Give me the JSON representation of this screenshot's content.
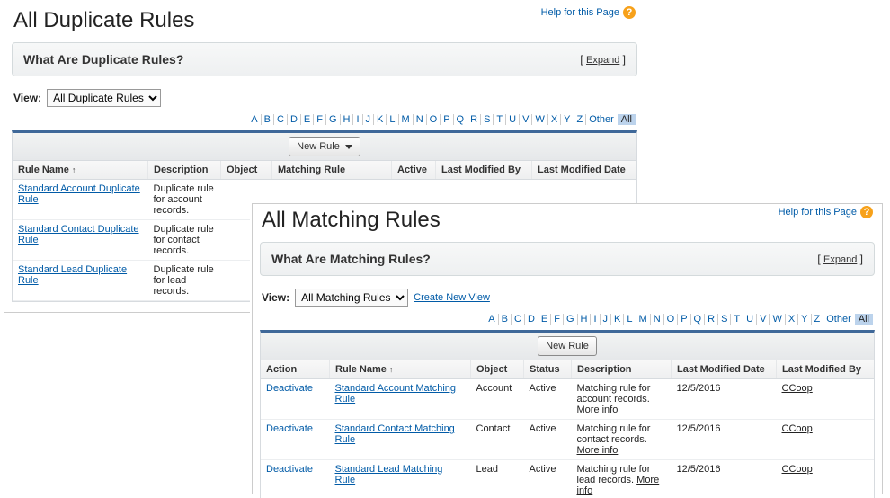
{
  "help_label": "Help for this Page",
  "expand_label": "Expand",
  "view_label": "View:",
  "other_label": "Other",
  "all_label": "All",
  "create_view_label": "Create New View",
  "sort_arrow": "↑",
  "dup": {
    "title": "All Duplicate Rules",
    "info_title": "What Are Duplicate Rules?",
    "view_value": "All Duplicate Rules",
    "new_button": "New Rule",
    "columns": {
      "rule": "Rule Name",
      "desc": "Description",
      "object": "Object",
      "matching": "Matching Rule",
      "active": "Active",
      "modby": "Last Modified By",
      "moddate": "Last Modified Date"
    },
    "rows": [
      {
        "name": "Standard Account Duplicate Rule",
        "desc": "Duplicate rule for account records."
      },
      {
        "name": "Standard Contact Duplicate Rule",
        "desc": "Duplicate rule for contact records."
      },
      {
        "name": "Standard Lead Duplicate Rule",
        "desc": "Duplicate rule for lead records."
      }
    ]
  },
  "match": {
    "title": "All Matching Rules",
    "info_title": "What Are Matching Rules?",
    "view_value": "All Matching Rules",
    "new_button": "New Rule",
    "columns": {
      "action": "Action",
      "rule": "Rule Name",
      "object": "Object",
      "status": "Status",
      "desc": "Description",
      "moddate": "Last Modified Date",
      "modby": "Last Modified By"
    },
    "rows": [
      {
        "action": "Deactivate",
        "name": "Standard Account Matching Rule",
        "object": "Account",
        "status": "Active",
        "desc": "Matching rule for account records.  ",
        "more": "More info",
        "moddate": "12/5/2016",
        "modby": "CCoop"
      },
      {
        "action": "Deactivate",
        "name": "Standard Contact Matching Rule",
        "object": "Contact",
        "status": "Active",
        "desc": "Matching rule for contact records.  ",
        "more": "More info",
        "moddate": "12/5/2016",
        "modby": "CCoop"
      },
      {
        "action": "Deactivate",
        "name": "Standard Lead Matching Rule",
        "object": "Lead",
        "status": "Active",
        "desc": "Matching rule for lead records.  ",
        "more": "More info",
        "moddate": "12/5/2016",
        "modby": "CCoop"
      }
    ]
  }
}
